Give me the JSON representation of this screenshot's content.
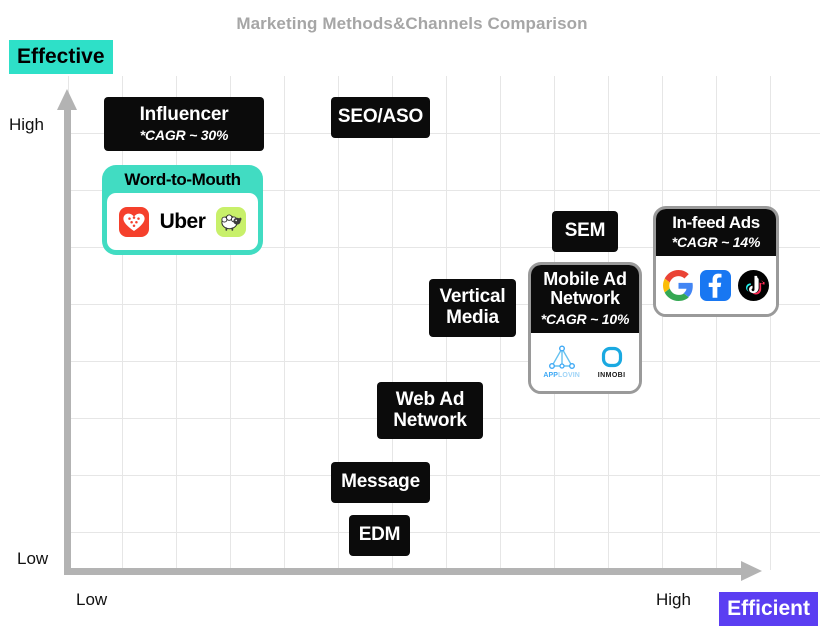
{
  "title": "Marketing Methods&Channels Comparison",
  "badges": {
    "y_badge": "Effective",
    "y_badge_color": "#2ee0c8",
    "x_badge": "Efficient",
    "x_badge_color": "#5b3ef2"
  },
  "axes": {
    "y_high": "High",
    "y_low": "Low",
    "x_low": "Low",
    "x_high": "High"
  },
  "chart_data": {
    "type": "scatter",
    "title": "Marketing Methods&Channels Comparison",
    "xlabel": "Efficient",
    "ylabel": "Effective",
    "xlim": [
      "Low",
      "High"
    ],
    "ylim": [
      "Low",
      "High"
    ],
    "grid": true,
    "legend": "none",
    "items": [
      {
        "label": "Influencer",
        "annotation": "*CAGR ~ 30%",
        "x": 0.12,
        "y": 0.94,
        "style": "black-box",
        "logos": []
      },
      {
        "label": "SEO/ASO",
        "annotation": "",
        "x": 0.4,
        "y": 0.94,
        "style": "black-box",
        "logos": []
      },
      {
        "label": "Word-to-Mouth",
        "annotation": "",
        "x": 0.13,
        "y": 0.8,
        "style": "teal-card",
        "logos": [
          "xiaohongshu-logo",
          "uber-logo",
          "sheep-logo"
        ]
      },
      {
        "label": "SEM",
        "annotation": "",
        "x": 0.72,
        "y": 0.72,
        "style": "black-box",
        "logos": []
      },
      {
        "label": "In-feed Ads",
        "annotation": "*CAGR ~ 14%",
        "x": 0.89,
        "y": 0.68,
        "style": "logo-card",
        "logos": [
          "google-logo",
          "facebook-logo",
          "tiktok-logo"
        ]
      },
      {
        "label": "Vertical Media",
        "annotation": "",
        "x": 0.53,
        "y": 0.55,
        "style": "black-box",
        "logos": []
      },
      {
        "label": "Mobile Ad Network",
        "annotation": "*CAGR ~ 10%",
        "x": 0.7,
        "y": 0.52,
        "style": "logo-card",
        "logos": [
          "applovin-logo",
          "inmobi-logo"
        ]
      },
      {
        "label": "Web Ad Network",
        "annotation": "",
        "x": 0.46,
        "y": 0.35,
        "style": "black-box",
        "logos": []
      },
      {
        "label": "Message",
        "annotation": "",
        "x": 0.4,
        "y": 0.2,
        "style": "black-box",
        "logos": []
      },
      {
        "label": "EDM",
        "annotation": "",
        "x": 0.42,
        "y": 0.09,
        "style": "black-box",
        "logos": []
      }
    ]
  },
  "boxes": {
    "influencer": {
      "title": "Influencer",
      "cagr": "*CAGR ~ 30%"
    },
    "seo_aso": {
      "title": "SEO/ASO"
    },
    "word_to_mouth": {
      "title": "Word-to-Mouth"
    },
    "sem": {
      "title": "SEM"
    },
    "in_feed_ads": {
      "title": "In-feed Ads",
      "cagr": "*CAGR ~ 14%"
    },
    "vertical_media": {
      "title_line1": "Vertical",
      "title_line2": "Media"
    },
    "mobile_ad_network": {
      "title_line1": "Mobile Ad",
      "title_line2": "Network",
      "cagr": "*CAGR ~ 10%"
    },
    "web_ad_network": {
      "title_line1": "Web Ad",
      "title_line2": "Network"
    },
    "message": {
      "title": "Message"
    },
    "edm": {
      "title": "EDM"
    }
  },
  "logos": {
    "uber": "Uber",
    "applovin_part1": "APP",
    "applovin_part2": "LOVIN",
    "inmobi": "INMOBI"
  }
}
